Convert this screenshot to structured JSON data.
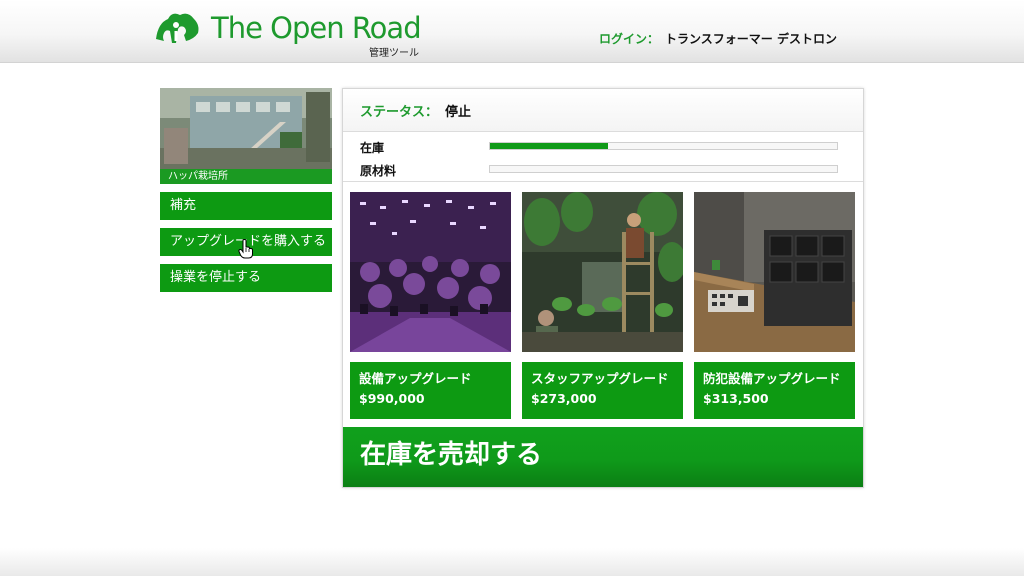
{
  "header": {
    "title": "The Open Road",
    "subtitle": "管理ツール",
    "login_label": "ログイン：",
    "login_user": "トランスフォーマー デストロン"
  },
  "business": {
    "name": "ハッパ栽培所"
  },
  "sidebar": {
    "items": [
      {
        "label": "補充"
      },
      {
        "label": "アップグレードを購入する"
      },
      {
        "label": "操業を停止する"
      }
    ]
  },
  "status": {
    "label": "ステータス：",
    "value": "停止"
  },
  "bars": [
    {
      "label": "在庫",
      "progress": 0.34
    },
    {
      "label": "原材料",
      "progress": 0.0
    }
  ],
  "upgrades": [
    {
      "name": "設備アップグレード",
      "price": "$990,000"
    },
    {
      "name": "スタッフアップグレード",
      "price": "$273,000"
    },
    {
      "name": "防犯設備アップグレード",
      "price": "$313,500"
    }
  ],
  "actions": {
    "sell_label": "在庫を売却する"
  },
  "colors": {
    "brand_green": "#1e9a2e",
    "button_green": "#0d9a12"
  },
  "icons": {
    "logo": "biker-logo-icon",
    "cursor": "hand-pointer-icon"
  }
}
